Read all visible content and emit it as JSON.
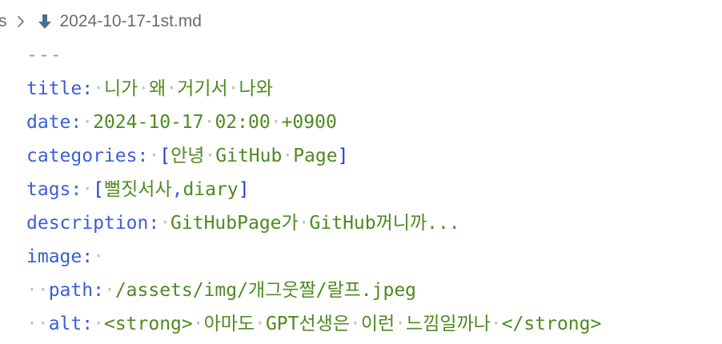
{
  "breadcrumb": {
    "prev_fragment": "s",
    "file_name": "2024-10-17-1st.md"
  },
  "lines": [
    {
      "parts": [
        {
          "c": "dash",
          "t": "---"
        }
      ]
    },
    {
      "parts": [
        {
          "c": "k",
          "t": "title"
        },
        {
          "c": "p",
          "t": ":"
        },
        {
          "c": "ws",
          "t": "·"
        },
        {
          "c": "s",
          "t": "니가"
        },
        {
          "c": "ws",
          "t": "·"
        },
        {
          "c": "s",
          "t": "왜"
        },
        {
          "c": "ws",
          "t": "·"
        },
        {
          "c": "s",
          "t": "거기서"
        },
        {
          "c": "ws",
          "t": "·"
        },
        {
          "c": "s",
          "t": "나와"
        }
      ]
    },
    {
      "parts": [
        {
          "c": "k",
          "t": "date"
        },
        {
          "c": "p",
          "t": ":"
        },
        {
          "c": "ws",
          "t": "·"
        },
        {
          "c": "n",
          "t": "2024-10-17"
        },
        {
          "c": "ws",
          "t": "·"
        },
        {
          "c": "n",
          "t": "02:00"
        },
        {
          "c": "ws",
          "t": "·"
        },
        {
          "c": "n",
          "t": "+0900"
        }
      ]
    },
    {
      "parts": [
        {
          "c": "k",
          "t": "categories"
        },
        {
          "c": "p",
          "t": ":"
        },
        {
          "c": "ws",
          "t": "·"
        },
        {
          "c": "b",
          "t": "["
        },
        {
          "c": "s",
          "t": "안녕"
        },
        {
          "c": "ws",
          "t": "·"
        },
        {
          "c": "s",
          "t": "GitHub"
        },
        {
          "c": "ws",
          "t": "·"
        },
        {
          "c": "s",
          "t": "Page"
        },
        {
          "c": "b",
          "t": "]"
        }
      ]
    },
    {
      "parts": [
        {
          "c": "k",
          "t": "tags"
        },
        {
          "c": "p",
          "t": ":"
        },
        {
          "c": "ws",
          "t": "·"
        },
        {
          "c": "b",
          "t": "["
        },
        {
          "c": "s",
          "t": "뻘짓서사"
        },
        {
          "c": "p",
          "t": ","
        },
        {
          "c": "s",
          "t": "diary"
        },
        {
          "c": "b",
          "t": "]"
        }
      ]
    },
    {
      "parts": [
        {
          "c": "k",
          "t": "description"
        },
        {
          "c": "p",
          "t": ":"
        },
        {
          "c": "ws",
          "t": "·"
        },
        {
          "c": "s",
          "t": "GitHubPage가"
        },
        {
          "c": "ws",
          "t": "·"
        },
        {
          "c": "s",
          "t": "GitHub꺼니까..."
        }
      ]
    },
    {
      "parts": [
        {
          "c": "k",
          "t": "image"
        },
        {
          "c": "p",
          "t": ":"
        },
        {
          "c": "ws",
          "t": "·"
        }
      ]
    },
    {
      "parts": [
        {
          "c": "ws",
          "t": "··"
        },
        {
          "c": "k",
          "t": "path"
        },
        {
          "c": "p",
          "t": ":"
        },
        {
          "c": "ws",
          "t": "·"
        },
        {
          "c": "s",
          "t": "/assets/img/개그웃짤/랄프.jpeg"
        }
      ]
    },
    {
      "parts": [
        {
          "c": "ws",
          "t": "··"
        },
        {
          "c": "k",
          "t": "alt"
        },
        {
          "c": "p",
          "t": ":"
        },
        {
          "c": "ws",
          "t": "·"
        },
        {
          "c": "s",
          "t": "<strong>"
        },
        {
          "c": "ws",
          "t": "·"
        },
        {
          "c": "s",
          "t": "아마도"
        },
        {
          "c": "ws",
          "t": "·"
        },
        {
          "c": "s",
          "t": "GPT선생은"
        },
        {
          "c": "ws",
          "t": "·"
        },
        {
          "c": "s",
          "t": "이런"
        },
        {
          "c": "ws",
          "t": "·"
        },
        {
          "c": "s",
          "t": "느낌일까나"
        },
        {
          "c": "ws",
          "t": "·"
        },
        {
          "c": "s",
          "t": "</strong>"
        }
      ]
    }
  ]
}
